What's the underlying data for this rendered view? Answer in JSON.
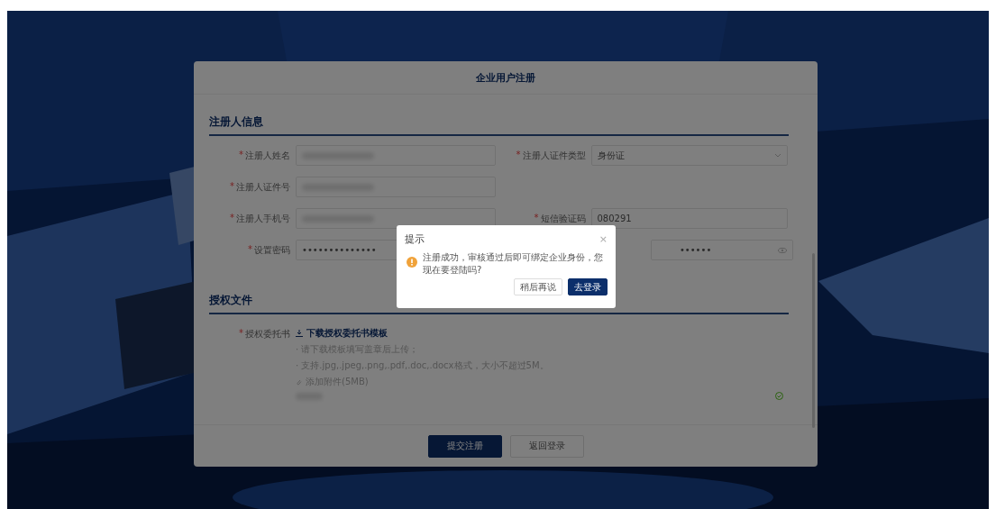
{
  "card": {
    "title": "企业用户注册"
  },
  "sections": [
    {
      "title": "注册人信息",
      "rows": [
        {
          "fields": [
            {
              "mark": "*",
              "label": "注册人姓名",
              "kind": "text",
              "redacted": true
            },
            {
              "mark": "*",
              "label": "注册人证件类型",
              "kind": "select",
              "value": "身份证"
            }
          ]
        },
        {
          "fields": [
            {
              "mark": "*",
              "label": "注册人证件号",
              "kind": "text",
              "redacted": true
            }
          ]
        },
        {
          "fields": [
            {
              "mark": "*",
              "label": "注册人手机号",
              "kind": "text",
              "redacted": true
            },
            {
              "mark": "*",
              "label": "短信验证码",
              "kind": "text",
              "value": "080291"
            }
          ]
        },
        {
          "fields": [
            {
              "mark": "*",
              "label": "设置密码",
              "kind": "password",
              "value": "••••••••••••••"
            },
            {
              "kind": "password",
              "value": "••••••",
              "eye": true
            }
          ]
        }
      ]
    },
    {
      "title": "授权文件",
      "upload": {
        "mark": "*",
        "label": "授权委托书",
        "link": "下载授权委托书模板",
        "hints": [
          "· 请下载模板填写盖章后上传；",
          "· 支持.jpg,.jpeg,.png,.pdf,.doc,.docx格式，大小不超过5M。"
        ],
        "attach": "添加附件(5MB)",
        "file_done": true
      }
    }
  ],
  "buttons": [
    {
      "label": "提交注册",
      "primary": true
    },
    {
      "label": "返回登录",
      "primary": false
    }
  ],
  "dialog": {
    "title": "提示",
    "close": "×",
    "message": "注册成功，审核通过后即可绑定企业身份，您现在要登陆吗?",
    "buttons": [
      {
        "label": "稍后再说",
        "primary": false
      },
      {
        "label": "去登录",
        "primary": true
      }
    ]
  }
}
